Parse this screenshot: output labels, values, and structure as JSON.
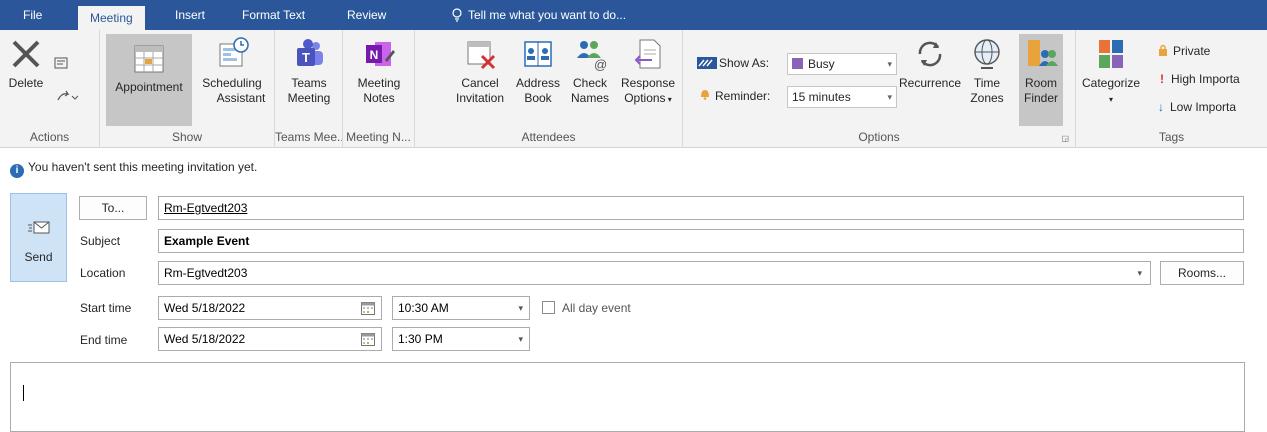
{
  "tabs": [
    {
      "label": "File"
    },
    {
      "label": "Meeting"
    },
    {
      "label": "Insert"
    },
    {
      "label": "Format Text"
    },
    {
      "label": "Review"
    }
  ],
  "tell_me": "Tell me what you want to do...",
  "ribbon": {
    "actions": {
      "delete": "Delete",
      "label": "Actions"
    },
    "show": {
      "appointment": "Appointment",
      "scheduling": "Scheduling",
      "assistant": "Assistant",
      "label": "Show"
    },
    "teams": {
      "l1": "Teams",
      "l2": "Meeting",
      "label": "Teams Mee..."
    },
    "notes": {
      "l1": "Meeting",
      "l2": "Notes",
      "label": "Meeting N..."
    },
    "attendees": {
      "cancel1": "Cancel",
      "cancel2": "Invitation",
      "address1": "Address",
      "address2": "Book",
      "check1": "Check",
      "check2": "Names",
      "response1": "Response",
      "response2": "Options",
      "label": "Attendees"
    },
    "options": {
      "show_as": "Show As:",
      "show_as_value": "Busy",
      "reminder": "Reminder:",
      "reminder_value": "15 minutes",
      "recurrence": "Recurrence",
      "time1": "Time",
      "time2": "Zones",
      "room1": "Room",
      "room2": "Finder",
      "label": "Options"
    },
    "tags": {
      "categorize": "Categorize",
      "private": "Private",
      "high": "High Importa",
      "low": "Low Importa",
      "label": "Tags"
    }
  },
  "info_bar": "You haven't sent this meeting invitation yet.",
  "form": {
    "send": "Send",
    "to_button": "To...",
    "to_value": "Rm-Egtvedt203",
    "subject_label": "Subject",
    "subject_value": "Example Event",
    "location_label": "Location",
    "location_value": "Rm-Egtvedt203",
    "rooms_button": "Rooms...",
    "start_label": "Start time",
    "start_date": "Wed 5/18/2022",
    "start_time": "10:30 AM",
    "all_day": "All day event",
    "end_label": "End time",
    "end_date": "Wed 5/18/2022",
    "end_time": "1:30 PM"
  }
}
